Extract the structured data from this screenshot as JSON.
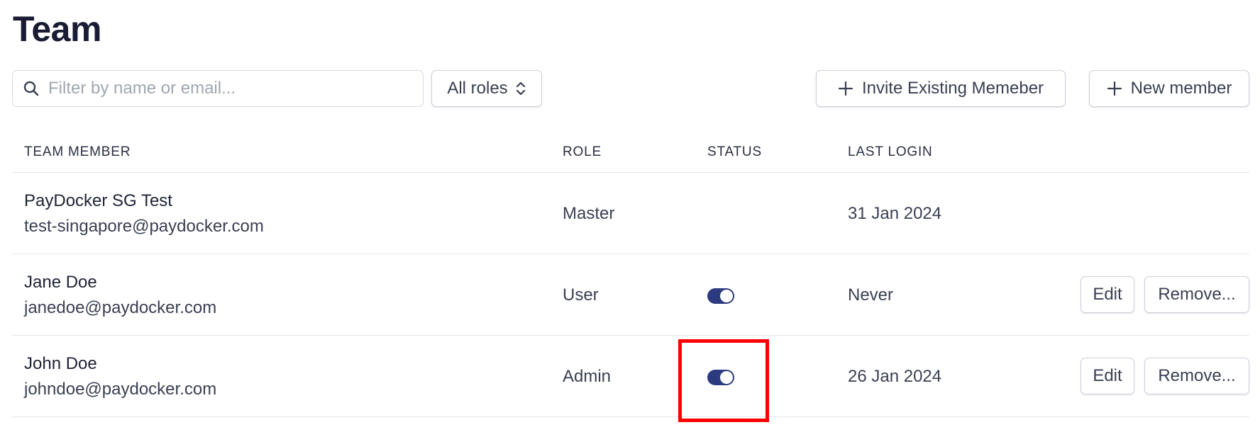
{
  "page": {
    "title": "Team"
  },
  "toolbar": {
    "search_placeholder": "Filter by name or email...",
    "roles_label": "All roles",
    "invite_label": "Invite Existing Memeber",
    "new_member_label": "New member"
  },
  "table": {
    "headers": [
      "TEAM MEMBER",
      "ROLE",
      "STATUS",
      "LAST LOGIN"
    ],
    "rows": [
      {
        "name": "PayDocker SG Test",
        "email": "test-singapore@paydocker.com",
        "role": "Master",
        "status": null,
        "last_login": "31 Jan 2024",
        "actions": []
      },
      {
        "name": "Jane Doe",
        "email": "janedoe@paydocker.com",
        "role": "User",
        "status": "active",
        "last_login": "Never",
        "actions": [
          "Edit",
          "Remove..."
        ]
      },
      {
        "name": "John Doe",
        "email": "johndoe@paydocker.com",
        "role": "Admin",
        "status": "active",
        "last_login": "26 Jan 2024",
        "actions": [
          "Edit",
          "Remove..."
        ]
      }
    ]
  },
  "icons": {
    "search": "search-icon",
    "plus": "plus-icon",
    "sort": "chevron-up-down-icon"
  },
  "colors": {
    "toggle_on": "#2c3b80",
    "highlight": "#ff0000"
  }
}
